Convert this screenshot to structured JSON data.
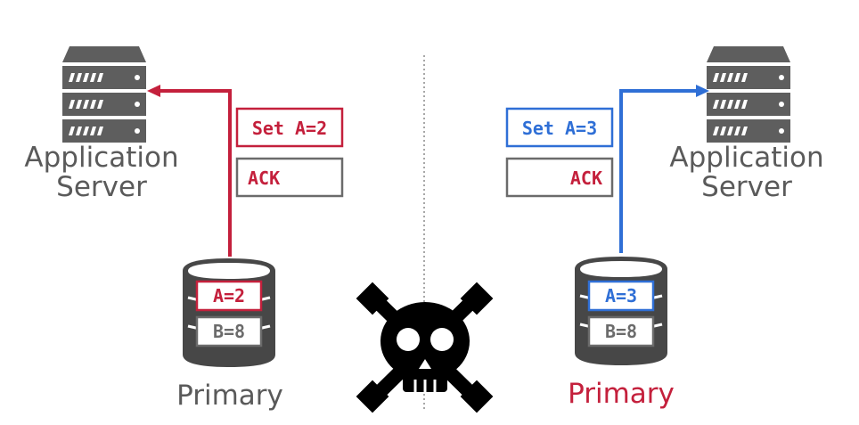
{
  "colors": {
    "red": "#c4203c",
    "blue": "#2f6fd6",
    "gray": "#6b6b6b",
    "server": "#5e5e5e",
    "db": "#474747",
    "skull": "#000000"
  },
  "left": {
    "server_label_line1": "Application",
    "server_label_line2": "Server",
    "msg_set": "Set A=2",
    "msg_ack": "ACK",
    "db_row1": "A=2",
    "db_row2": "B=8",
    "db_label": "Primary"
  },
  "right": {
    "server_label_line1": "Application",
    "server_label_line2": "Server",
    "msg_set": "Set A=3",
    "msg_ack": "ACK",
    "db_row1": "A=3",
    "db_row2": "B=8",
    "db_label": "Primary"
  },
  "icons": {
    "server": "server-rack-icon",
    "database": "database-icon",
    "failure": "skull-crossbones-icon"
  }
}
